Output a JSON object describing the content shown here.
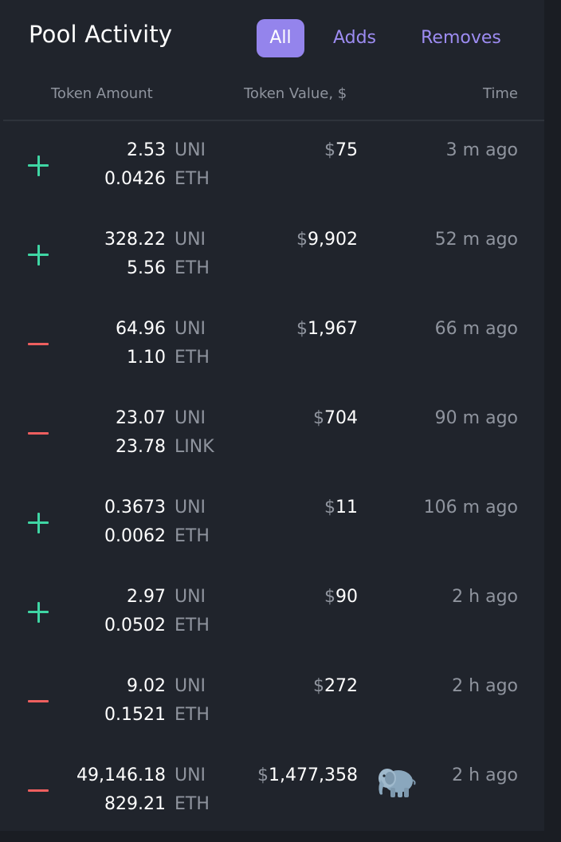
{
  "header": {
    "title": "Pool Activity",
    "filters": [
      "All",
      "Adds",
      "Removes"
    ],
    "active_filter": "All"
  },
  "columns": {
    "token_amount": "Token Amount",
    "token_value": "Token Value, $",
    "time": "Time"
  },
  "currency_symbol": "$",
  "colors": {
    "add": "#3fd6a4",
    "remove": "#ee5f5f",
    "accent": "#9484ec"
  },
  "rows": [
    {
      "type": "add",
      "amount1": "2.53",
      "symbol1": "UNI",
      "amount2": "0.0426",
      "symbol2": "ETH",
      "value": "75",
      "time": "3 m ago",
      "whale": false
    },
    {
      "type": "add",
      "amount1": "328.22",
      "symbol1": "UNI",
      "amount2": "5.56",
      "symbol2": "ETH",
      "value": "9,902",
      "time": "52 m ago",
      "whale": false
    },
    {
      "type": "remove",
      "amount1": "64.96",
      "symbol1": "UNI",
      "amount2": "1.10",
      "symbol2": "ETH",
      "value": "1,967",
      "time": "66 m ago",
      "whale": false
    },
    {
      "type": "remove",
      "amount1": "23.07",
      "symbol1": "UNI",
      "amount2": "23.78",
      "symbol2": "LINK",
      "value": "704",
      "time": "90 m ago",
      "whale": false
    },
    {
      "type": "add",
      "amount1": "0.3673",
      "symbol1": "UNI",
      "amount2": "0.0062",
      "symbol2": "ETH",
      "value": "11",
      "time": "106 m ago",
      "whale": false
    },
    {
      "type": "add",
      "amount1": "2.97",
      "symbol1": "UNI",
      "amount2": "0.0502",
      "symbol2": "ETH",
      "value": "90",
      "time": "2 h ago",
      "whale": false
    },
    {
      "type": "remove",
      "amount1": "9.02",
      "symbol1": "UNI",
      "amount2": "0.1521",
      "symbol2": "ETH",
      "value": "272",
      "time": "2 h ago",
      "whale": false
    },
    {
      "type": "remove",
      "amount1": "49,146.18",
      "symbol1": "UNI",
      "amount2": "829.21",
      "symbol2": "ETH",
      "value": "1,477,358",
      "time": "2 h ago",
      "whale": true,
      "whale_icon": "elephant-icon"
    }
  ]
}
